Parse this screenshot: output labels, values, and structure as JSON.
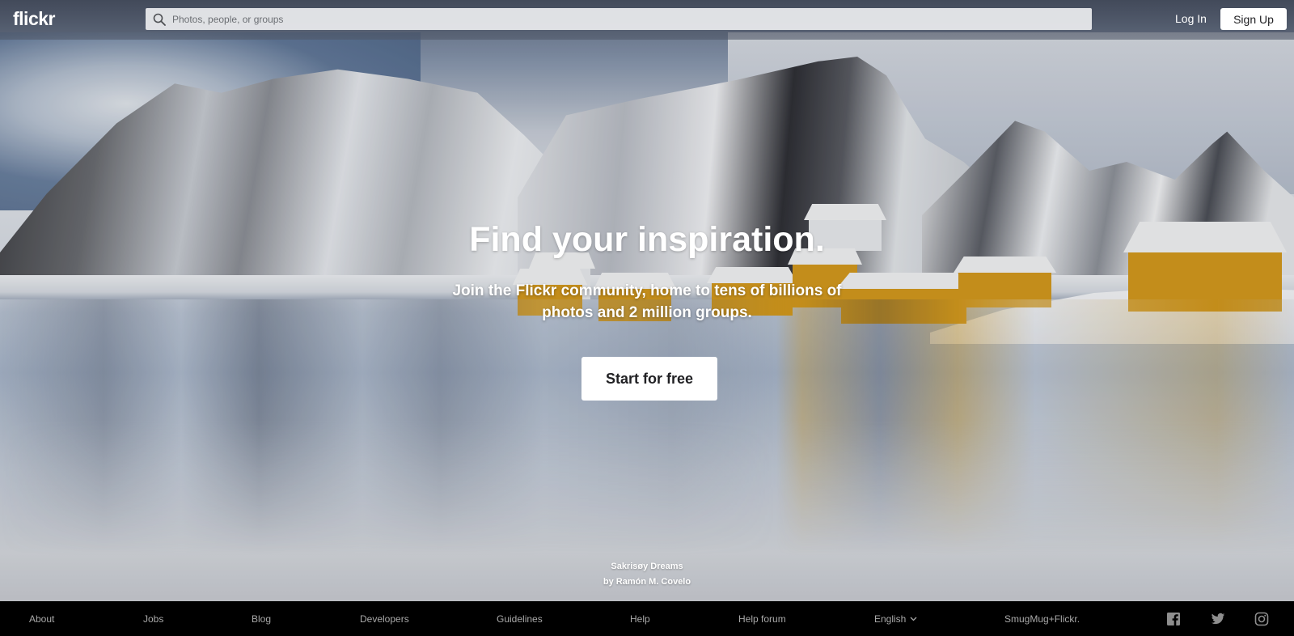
{
  "header": {
    "logo": "flickr",
    "search": {
      "placeholder": "Photos, people, or groups",
      "value": ""
    },
    "login_label": "Log In",
    "signup_label": "Sign Up"
  },
  "hero": {
    "title": "Find your inspiration.",
    "subtitle": "Join the Flickr community, home to tens of billions of photos and 2 million groups.",
    "cta_label": "Start for free",
    "photo_title": "Sakrisøy Dreams",
    "photo_author": "by Ramón M. Covelo"
  },
  "footer": {
    "links": [
      "About",
      "Jobs",
      "Blog",
      "Developers",
      "Guidelines",
      "Help",
      "Help forum"
    ],
    "language": "English",
    "brand": "SmugMug+Flickr.",
    "social": [
      "facebook-icon",
      "twitter-icon",
      "instagram-icon"
    ]
  },
  "colors": {
    "footer_bg": "#000000",
    "footer_text": "#a9a9a9",
    "button_bg": "#ffffff",
    "button_text": "#212124",
    "house_yellow": "#d49a1e"
  }
}
